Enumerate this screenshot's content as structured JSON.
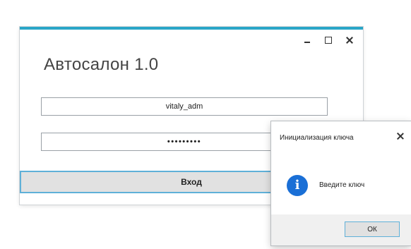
{
  "main_window": {
    "title": "Автосалон 1.0",
    "accent_color": "#2aa6c8",
    "controls": {
      "minimize_icon": "minimize-icon",
      "maximize_icon": "maximize-icon",
      "close_icon": "close-icon"
    },
    "username_field": {
      "value": "vitaly_adm"
    },
    "password_field": {
      "value": "•••••••••"
    },
    "login_button": {
      "label": "Вход"
    }
  },
  "dialog": {
    "title": "Инициализация ключа",
    "icon": "info-icon",
    "icon_color": "#1a6fd6",
    "icon_glyph": "i",
    "message": "Введите ключ",
    "ok_button": {
      "label": "ОК"
    }
  }
}
